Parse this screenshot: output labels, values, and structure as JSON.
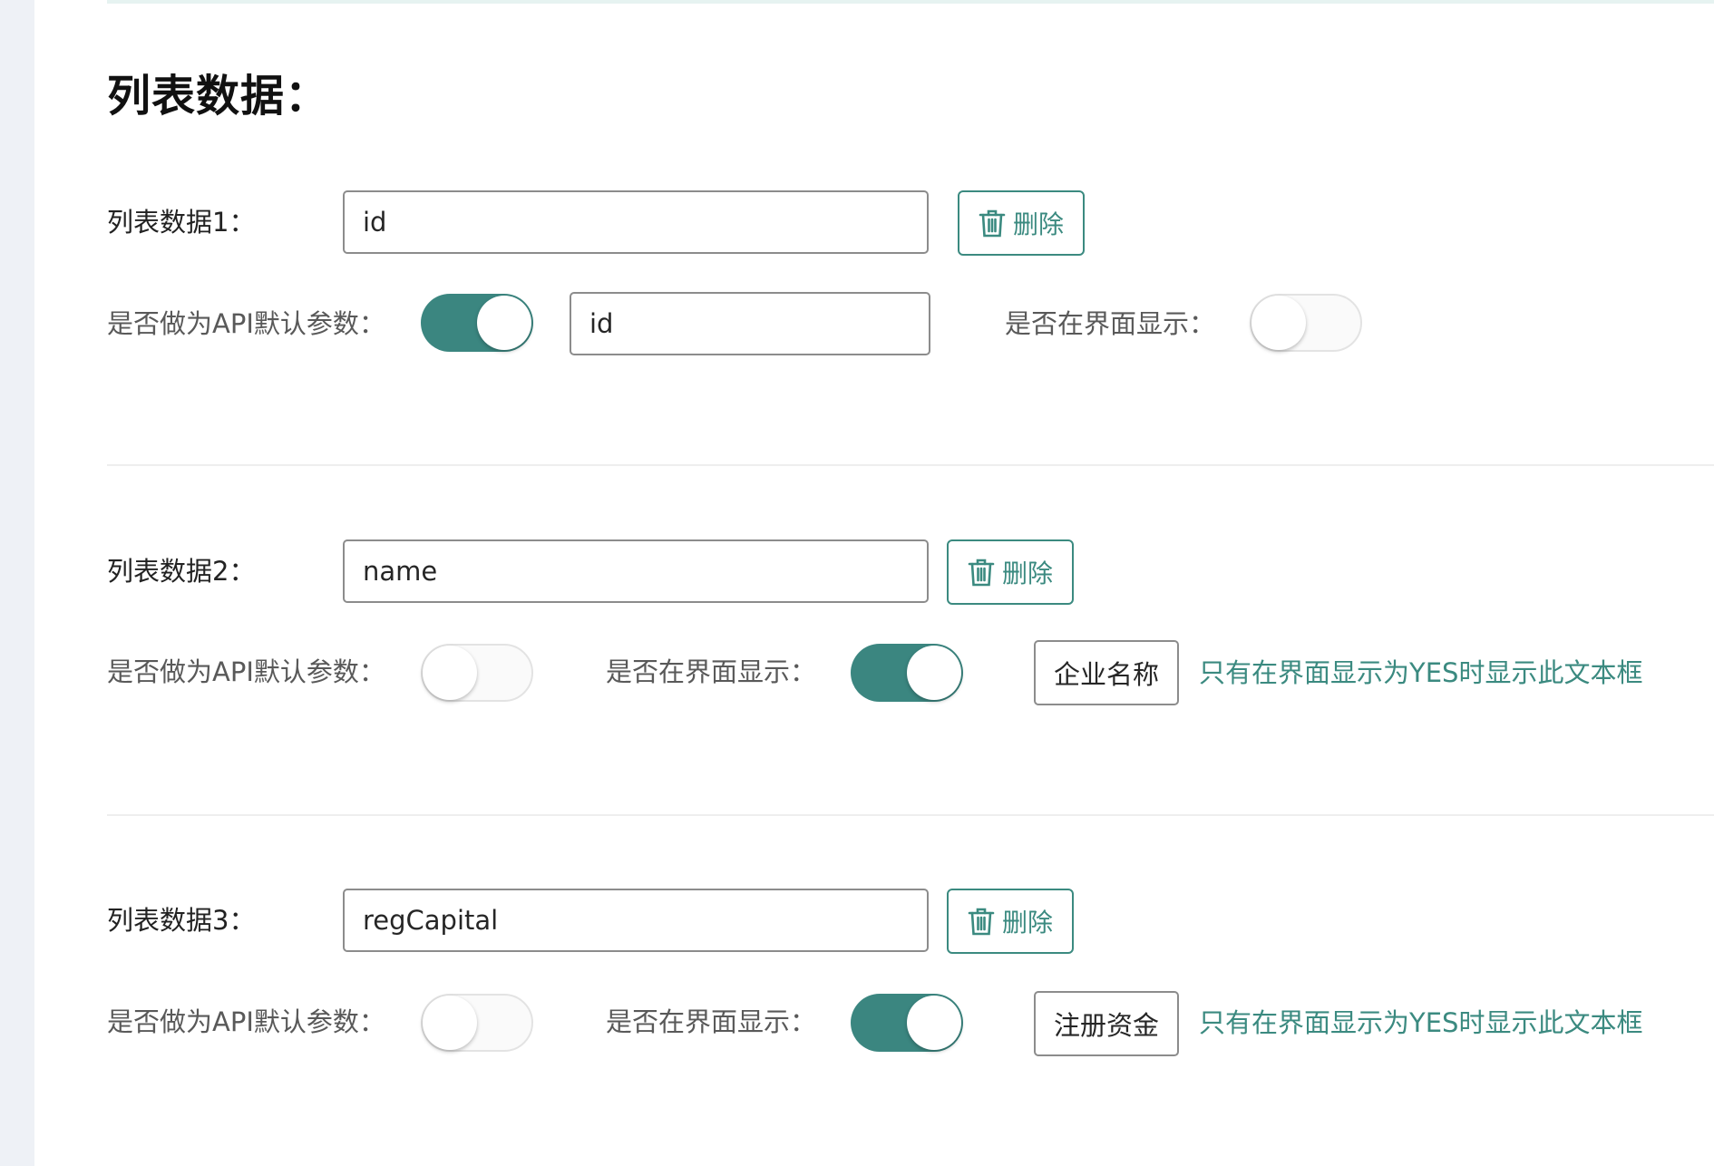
{
  "page": {
    "title": "列表数据："
  },
  "rows": [
    {
      "label": "列表数据1：",
      "value": "id",
      "delete_label": "删除",
      "api_default_label": "是否做为API默认参数：",
      "api_default_on": true,
      "api_param_value": "id",
      "show_label": "是否在界面显示：",
      "show_on": false
    },
    {
      "label": "列表数据2：",
      "value": "name",
      "delete_label": "删除",
      "api_default_label": "是否做为API默认参数：",
      "api_default_on": false,
      "show_label": "是否在界面显示：",
      "show_on": true,
      "display_name": "企业名称",
      "hint": "只有在界面显示为YES时显示此文本框"
    },
    {
      "label": "列表数据3：",
      "value": "regCapital",
      "delete_label": "删除",
      "api_default_label": "是否做为API默认参数：",
      "api_default_on": false,
      "show_label": "是否在界面显示：",
      "show_on": true,
      "display_name": "注册资金",
      "hint": "只有在界面显示为YES时显示此文本框"
    }
  ],
  "icons": {
    "delete": "trash-icon"
  },
  "colors": {
    "accent": "#3b8a80",
    "toggle_on": "#3b8680",
    "sidebar": "#eef1f6"
  }
}
